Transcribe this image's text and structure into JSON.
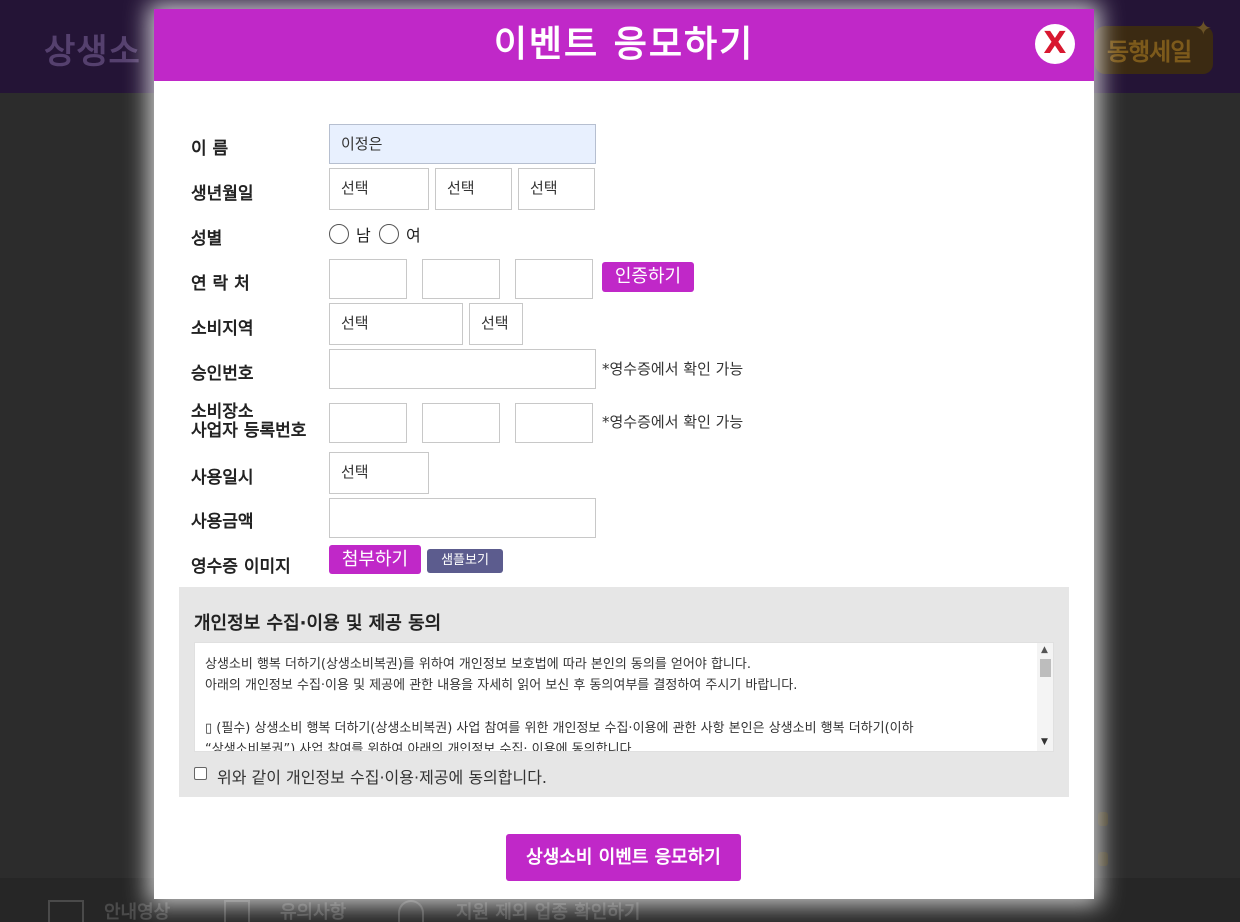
{
  "background": {
    "logo_text": "상생소",
    "badge_text": "동행세일",
    "footer_items": [
      "안내영상",
      "유의사항",
      "지원 제외 업종 확인하기"
    ]
  },
  "modal": {
    "title": "이벤트 응모하기",
    "close_label": "X",
    "fields": {
      "name_label": "이 름",
      "name_value": "이정은",
      "birth_label": "생년월일",
      "birth_year": "선택",
      "birth_month": "선택",
      "birth_day": "선택",
      "gender_label": "성별",
      "gender_male": "남",
      "gender_female": "여",
      "phone_label": "연 락 처",
      "verify_button": "인증하기",
      "region_label": "소비지역",
      "region_city": "선택",
      "region_district": "선택",
      "approval_label": "승인번호",
      "approval_note": "*영수증에서 확인 가능",
      "biz_label_1": "소비장소",
      "biz_label_2": "사업자 등록번호",
      "biz_note": "*영수증에서 확인 가능",
      "use_date_label": "사용일시",
      "use_date_value": "선택",
      "amount_label": "사용금액",
      "receipt_label": "영수증 이미지",
      "attach_button": "첨부하기",
      "sample_button": "샘플보기"
    },
    "consent": {
      "title": "개인정보 수집·이용 및 제공 동의",
      "lines": [
        "상생소비 행복 더하기(상생소비복권)를 위하여 개인정보 보호법에 따라 본인의 동의를 얻어야 합니다.",
        "아래의 개인정보 수집·이용 및 제공에 관한 내용을 자세히 읽어 보신 후 동의여부를 결정하여 주시기 바랍니다.",
        "",
        "▯ (필수) 상생소비 행복 더하기(상생소비복권) 사업 참여를 위한 개인정보 수집·이용에 관한 사항 본인은 상생소비 행복 더하기(이하",
        "“상생소비복권”) 사업 참여를 위하여 아래의 개인정보 수집· 이용에 동의합니다."
      ],
      "checkbox_label": "위와 같이 개인정보 수집·이용·제공에 동의합니다."
    },
    "submit_button": "상생소비 이벤트 응모하기"
  }
}
